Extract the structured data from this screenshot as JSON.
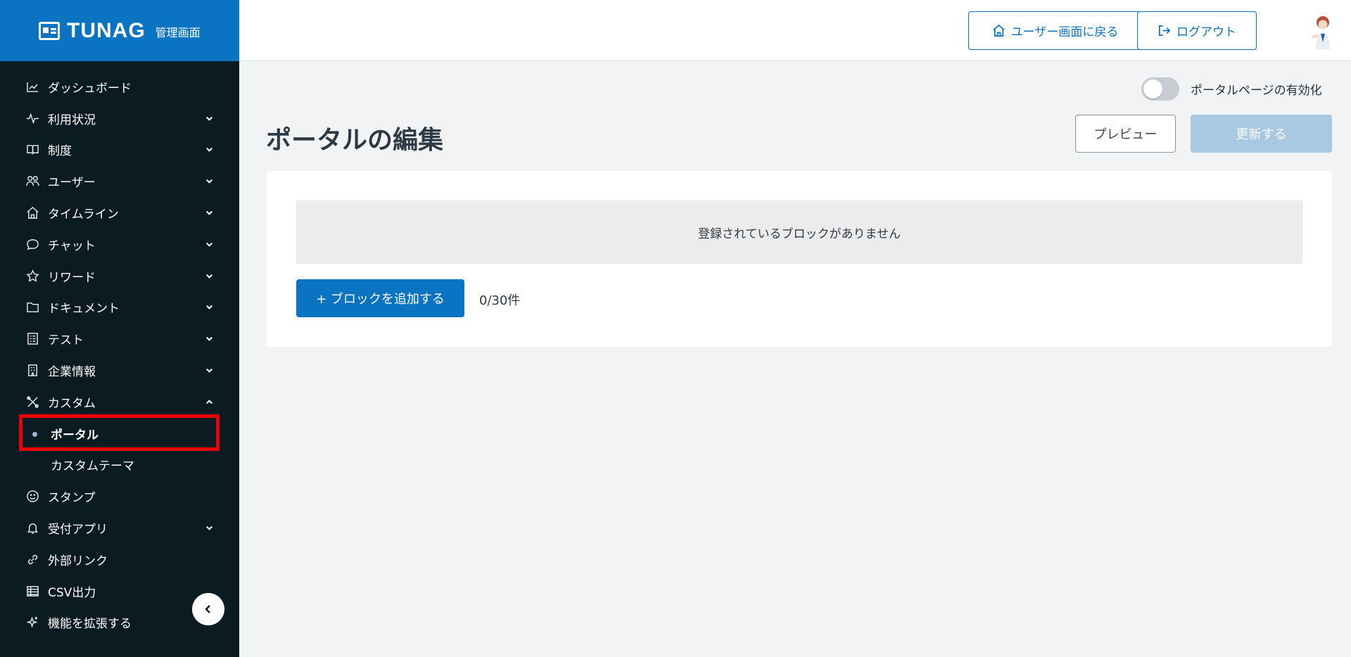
{
  "brand": {
    "name": "TUNAG",
    "sub": "管理画面"
  },
  "sidebar": {
    "items": [
      {
        "label": "ダッシュボード",
        "icon": "chart-line-icon",
        "chevron": ""
      },
      {
        "label": "利用状況",
        "icon": "activity-icon",
        "chevron": "down"
      },
      {
        "label": "制度",
        "icon": "book-icon",
        "chevron": "down"
      },
      {
        "label": "ユーザー",
        "icon": "users-icon",
        "chevron": "down"
      },
      {
        "label": "タイムライン",
        "icon": "home-icon",
        "chevron": "down"
      },
      {
        "label": "チャット",
        "icon": "chat-icon",
        "chevron": "down"
      },
      {
        "label": "リワード",
        "icon": "star-icon",
        "chevron": "down"
      },
      {
        "label": "ドキュメント",
        "icon": "folder-icon",
        "chevron": "down"
      },
      {
        "label": "テスト",
        "icon": "checklist-icon",
        "chevron": "down"
      },
      {
        "label": "企業情報",
        "icon": "building-icon",
        "chevron": "down"
      },
      {
        "label": "カスタム",
        "icon": "tools-icon",
        "chevron": "up"
      }
    ],
    "sub_items": [
      {
        "label": "ポータル",
        "active": true
      },
      {
        "label": "カスタムテーマ",
        "active": false
      }
    ],
    "items_after": [
      {
        "label": "スタンプ",
        "icon": "smile-icon",
        "chevron": ""
      },
      {
        "label": "受付アプリ",
        "icon": "bell-icon",
        "chevron": "down"
      },
      {
        "label": "外部リンク",
        "icon": "link-icon",
        "chevron": ""
      },
      {
        "label": "CSV出力",
        "icon": "table-icon",
        "chevron": ""
      },
      {
        "label": "機能を拡張する",
        "icon": "sparkle-icon",
        "chevron": ""
      }
    ]
  },
  "header": {
    "user_screen_label": "ユーザー画面に戻る",
    "logout_label": "ログアウト"
  },
  "main": {
    "toggle_label": "ポータルページの有効化",
    "toggle_on": false,
    "title": "ポータルの編集",
    "preview_label": "プレビュー",
    "update_label": "更新する",
    "empty_message": "登録されているブロックがありません",
    "add_block_label": "+ ブロックを追加する",
    "count": "0/30件"
  },
  "colors": {
    "brand": "#0a74c2",
    "sidebar_bg": "#0b1b22",
    "update_disabled": "#a9c9e2",
    "highlight": "#ee0000"
  }
}
